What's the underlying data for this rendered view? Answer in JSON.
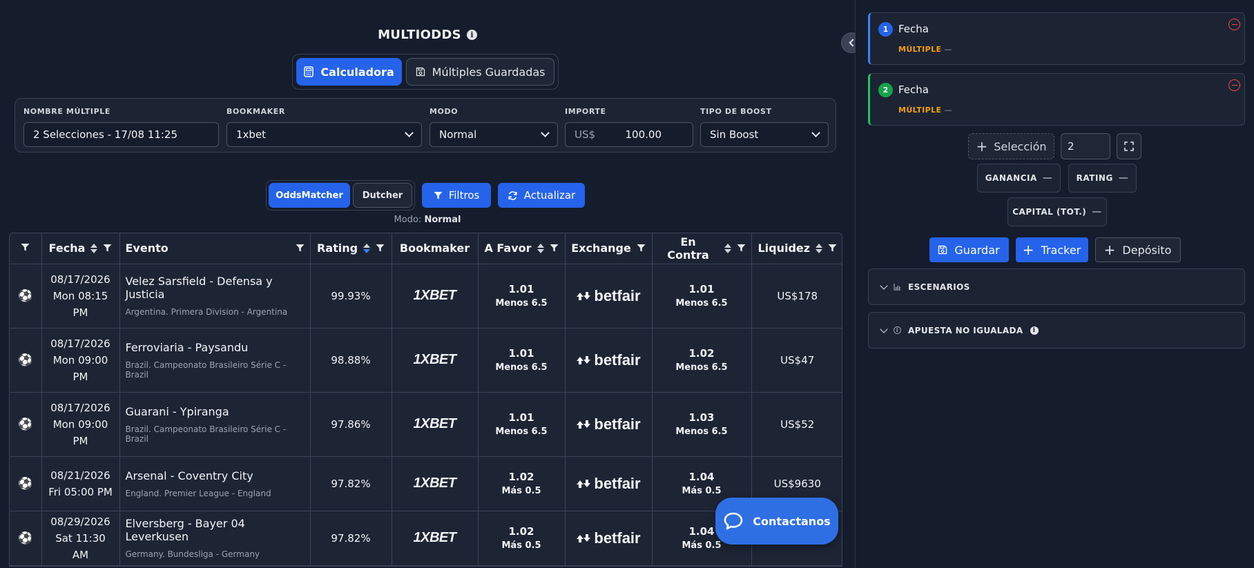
{
  "app": {
    "title": "MULTIODDS"
  },
  "tabs": [
    {
      "label": "Calculadora",
      "active": true
    },
    {
      "label": "Múltiples Guardadas",
      "active": false
    }
  ],
  "config": {
    "nombre": {
      "label": "NOMBRE MÚLTIPLE",
      "value": "2 Selecciones - 17/08 11:25"
    },
    "bookmaker": {
      "label": "BOOKMAKER",
      "value": "1xbet"
    },
    "modo": {
      "label": "MODO",
      "value": "Normal"
    },
    "importe": {
      "label": "IMPORTE",
      "currency": "US$",
      "value": "100.00"
    },
    "boost": {
      "label": "TIPO DE BOOST",
      "value": "Sin Boost"
    }
  },
  "toolbar": {
    "oddsmatcher": "OddsMatcher",
    "dutcher": "Dutcher",
    "filtros": "Filtros",
    "actualizar": "Actualizar",
    "modo_prefix": "Modo:",
    "modo_value": "Normal"
  },
  "table": {
    "headers": [
      "Fecha",
      "Evento",
      "Rating",
      "Bookmaker",
      "A Favor",
      "Exchange",
      "En Contra",
      "Liquidez"
    ],
    "rows": [
      {
        "date1": "08/17/2026",
        "date2": "Mon 08:15",
        "date3": "PM",
        "event": "Velez Sarsfield - Defensa y Justicia",
        "league": "Argentina. Primera Division - Argentina",
        "rating": "99.93%",
        "bookmaker": "1XBET",
        "favor": "1.01",
        "favor_line": "Menos 6.5",
        "exchange": "betfair",
        "contra": "1.01",
        "contra_line": "Menos 6.5",
        "liquidez": "US$178"
      },
      {
        "date1": "08/17/2026",
        "date2": "Mon 09:00",
        "date3": "PM",
        "event": "Ferroviaria - Paysandu",
        "league": "Brazil. Campeonato Brasileiro Série C - Brazil",
        "rating": "98.88%",
        "bookmaker": "1XBET",
        "favor": "1.01",
        "favor_line": "Menos 6.5",
        "exchange": "betfair",
        "contra": "1.02",
        "contra_line": "Menos 6.5",
        "liquidez": "US$47"
      },
      {
        "date1": "08/17/2026",
        "date2": "Mon 09:00",
        "date3": "PM",
        "event": "Guarani - Ypiranga",
        "league": "Brazil. Campeonato Brasileiro Série C - Brazil",
        "rating": "97.86%",
        "bookmaker": "1XBET",
        "favor": "1.01",
        "favor_line": "Menos 6.5",
        "exchange": "betfair",
        "contra": "1.03",
        "contra_line": "Menos 6.5",
        "liquidez": "US$52"
      },
      {
        "date1": "08/21/2026",
        "date2": "Fri 05:00 PM",
        "date3": "",
        "event": "Arsenal - Coventry City",
        "league": "England. Premier League - England",
        "rating": "97.82%",
        "bookmaker": "1XBET",
        "favor": "1.02",
        "favor_line": "Más 0.5",
        "exchange": "betfair",
        "contra": "1.04",
        "contra_line": "Más 0.5",
        "liquidez": "US$9630"
      },
      {
        "date1": "08/29/2026",
        "date2": "Sat 11:30 AM",
        "date3": "",
        "event": "Elversberg - Bayer 04 Leverkusen",
        "league": "Germany. Bundesliga - Germany",
        "rating": "97.82%",
        "bookmaker": "1XBET",
        "favor": "1.02",
        "favor_line": "Más 0.5",
        "exchange": "betfair",
        "contra": "1.04",
        "contra_line": "Más 0.5",
        "liquidez": ""
      }
    ]
  },
  "contact": {
    "label": "Contactanos"
  },
  "sidebar": {
    "legs": [
      {
        "num": "1",
        "title": "Fecha",
        "tag": "MÚLTIPLE",
        "value": "—"
      },
      {
        "num": "2",
        "title": "Fecha",
        "tag": "MÚLTIPLE",
        "value": "—"
      }
    ],
    "seleccion": "Selección",
    "count": "2",
    "stats": {
      "ganancia": {
        "label": "GANANCIA",
        "value": "—"
      },
      "rating": {
        "label": "RATING",
        "value": "—"
      },
      "capital": {
        "label": "CAPITAL (TOT.)",
        "value": "—"
      }
    },
    "actions": {
      "guardar": "Guardar",
      "tracker": "Tracker",
      "deposito": "Depósito"
    },
    "accordions": {
      "escenarios": "ESCENARIOS",
      "apuesta": "APUESTA NO IGUALADA"
    }
  },
  "colors": {
    "accent": "#2563eb",
    "warning": "#f59e0b",
    "danger": "#ef4444",
    "success": "#22c55e",
    "background": "#151c2c"
  }
}
